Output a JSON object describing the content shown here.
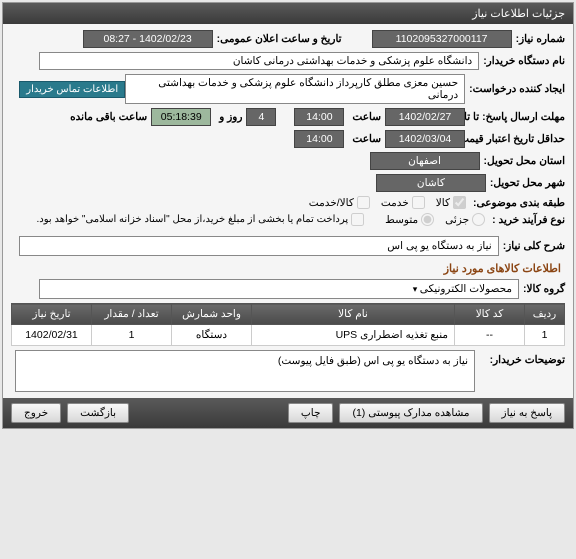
{
  "header": {
    "title": "جزئیات اطلاعات نیاز"
  },
  "fields": {
    "need_number_label": "شماره نیاز:",
    "need_number": "1102095327000117",
    "announce_datetime_label": "تاریخ و ساعت اعلان عمومی:",
    "announce_datetime": "1402/02/23 - 08:27",
    "buyer_org_label": "نام دستگاه خریدار:",
    "buyer_org": "دانشگاه علوم پزشکی و خدمات بهداشتی درمانی کاشان",
    "requester_label": "ایجاد کننده درخواست:",
    "requester": "حسین معزی مطلق کارپرداز دانشگاه علوم پزشکی و خدمات بهداشتی درمانی",
    "contact_btn": "اطلاعات تماس خریدار",
    "deadline_label": "مهلت ارسال پاسخ: تا تاریخ:",
    "deadline_date": "1402/02/27",
    "hour_label": "ساعت",
    "deadline_time": "14:00",
    "and_label": "روز و",
    "days_remaining": "4",
    "time_remaining": "05:18:39",
    "remaining_label": "ساعت باقی مانده",
    "validity_label": "حداقل تاریخ اعتبار قیمت: تا تاریخ:",
    "validity_date": "1402/03/04",
    "validity_time": "14:00",
    "province_label": "استان محل تحویل:",
    "province": "اصفهان",
    "city_label": "شهر محل تحویل:",
    "city": "کاشان",
    "category_label": "طبقه بندی موضوعی:",
    "cat_goods": "کالا",
    "cat_service": "خدمت",
    "cat_goods_service": "کالا/خدمت",
    "purchase_type_label": "نوع فرآیند خرید :",
    "type_minor": "جزئی",
    "type_medium": "متوسط",
    "payment_note": "پرداخت تمام یا بخشی از مبلغ خرید،از محل \"اسناد خزانه اسلامی\" خواهد بود.",
    "summary_label": "شرح کلی نیاز:",
    "summary": "نیاز به دستگاه یو پی اس",
    "goods_info_title": "اطلاعات کالاهای مورد نیاز",
    "goods_group_label": "گروه کالا:",
    "goods_group": "محصولات الکترونیکی",
    "buyer_notes_label": "توضیحات خریدار:",
    "buyer_notes": "نیاز به دستگاه یو پی اس (طبق فایل پیوست)"
  },
  "table": {
    "headers": {
      "row": "ردیف",
      "code": "کد کالا",
      "name": "نام کالا",
      "unit": "واحد شمارش",
      "qty": "تعداد / مقدار",
      "date": "تاریخ نیاز"
    },
    "rows": [
      {
        "row": "1",
        "code": "--",
        "name": "منبع تغذیه اضطراری UPS",
        "unit": "دستگاه",
        "qty": "1",
        "date": "1402/02/31"
      }
    ]
  },
  "buttons": {
    "respond": "پاسخ به نیاز",
    "attachments": "مشاهده مدارک پیوستی (1)",
    "print": "چاپ",
    "back": "بازگشت",
    "exit": "خروج"
  }
}
